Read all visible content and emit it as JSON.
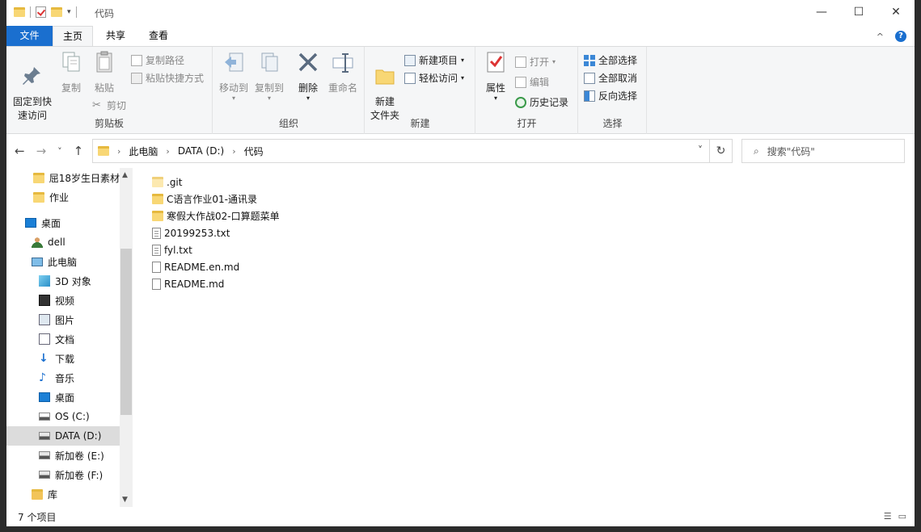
{
  "window": {
    "title": "代码",
    "minimize_icon": "—",
    "maximize_icon": "☐",
    "close_icon": "✕"
  },
  "ribbon_tabs": {
    "file": "文件",
    "home": "主页",
    "share": "共享",
    "view": "查看",
    "collapse_icon": "^",
    "help_icon": "?"
  },
  "ribbon": {
    "clipboard": {
      "label": "剪贴板",
      "pin": "固定到快\n速访问",
      "copy": "复制",
      "paste": "粘贴",
      "copy_path": "复制路径",
      "paste_shortcut": "粘贴快捷方式",
      "cut": "剪切"
    },
    "organize": {
      "label": "组织",
      "move_to": "移动到",
      "copy_to": "复制到",
      "delete": "删除",
      "rename": "重命名"
    },
    "new": {
      "label": "新建",
      "new_folder": "新建\n文件夹",
      "new_item": "新建项目",
      "easy_access": "轻松访问"
    },
    "open": {
      "label": "打开",
      "properties": "属性",
      "open": "打开",
      "edit": "编辑",
      "history": "历史记录"
    },
    "select": {
      "label": "选择",
      "select_all": "全部选择",
      "select_none": "全部取消",
      "invert": "反向选择"
    }
  },
  "navigation": {
    "back": "←",
    "forward": "→",
    "recent": "˅",
    "up": "↑",
    "crumbs": [
      "此电脑",
      "DATA (D:)",
      "代码"
    ],
    "crumb_sep": "›",
    "dropdown": "˅",
    "refresh": "↻",
    "search_placeholder": "搜索\"代码\"",
    "search_icon": "⌕"
  },
  "sidebar": {
    "items": [
      {
        "label": "屈18岁生日素材",
        "icon": "folder-icon"
      },
      {
        "label": "作业",
        "icon": "folder-icon"
      },
      {
        "label": "桌面",
        "icon": "desktop-icon"
      },
      {
        "label": "dell",
        "icon": "user-icon"
      },
      {
        "label": "此电脑",
        "icon": "computer-icon"
      },
      {
        "label": "3D 对象",
        "icon": "cube-icon"
      },
      {
        "label": "视频",
        "icon": "video-icon"
      },
      {
        "label": "图片",
        "icon": "picture-icon"
      },
      {
        "label": "文档",
        "icon": "document-icon"
      },
      {
        "label": "下载",
        "icon": "download-icon"
      },
      {
        "label": "音乐",
        "icon": "music-icon"
      },
      {
        "label": "桌面",
        "icon": "desktop-icon"
      },
      {
        "label": "OS (C:)",
        "icon": "drive-icon"
      },
      {
        "label": "DATA (D:)",
        "icon": "drive-icon"
      },
      {
        "label": "新加卷 (E:)",
        "icon": "drive-icon"
      },
      {
        "label": "新加卷 (F:)",
        "icon": "drive-icon"
      },
      {
        "label": "库",
        "icon": "library-icon"
      }
    ],
    "selected_index": 13
  },
  "files": [
    {
      "name": ".git",
      "type": "folder-hidden"
    },
    {
      "name": "C语言作业01-通讯录",
      "type": "folder"
    },
    {
      "name": "寒假大作战02-口算题菜单",
      "type": "folder"
    },
    {
      "name": "20199253.txt",
      "type": "txt"
    },
    {
      "name": "fyl.txt",
      "type": "txt"
    },
    {
      "name": "README.en.md",
      "type": "md"
    },
    {
      "name": "README.md",
      "type": "md"
    }
  ],
  "status": {
    "item_count": "7 个项目"
  },
  "colors": {
    "accent": "#1a6fcf",
    "folder": "#f8d775",
    "ribbon_bg": "#f5f6f7",
    "selected_bg": "#dcdcdc"
  }
}
